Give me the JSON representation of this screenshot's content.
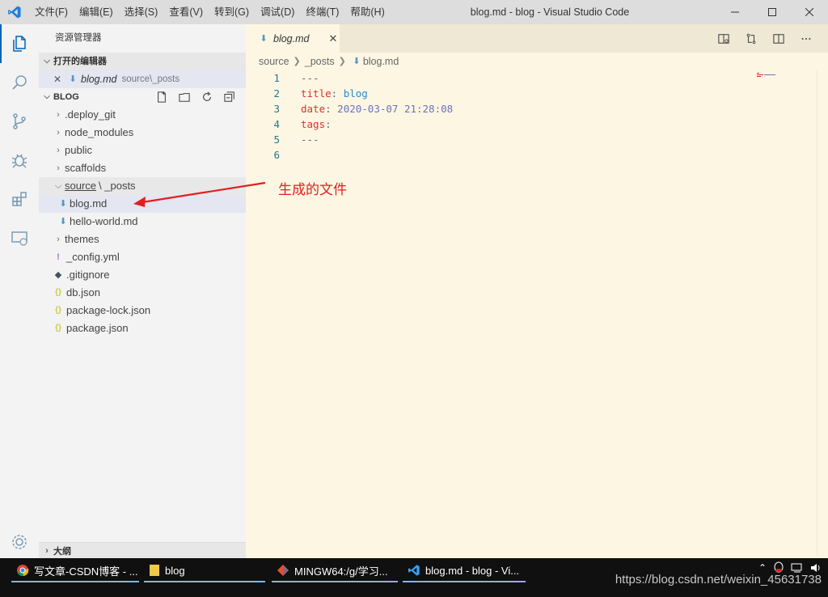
{
  "window": {
    "title": "blog.md - blog - Visual Studio Code"
  },
  "menu": [
    "文件(F)",
    "编辑(E)",
    "选择(S)",
    "查看(V)",
    "转到(G)",
    "调试(D)",
    "终端(T)",
    "帮助(H)"
  ],
  "sidebar": {
    "title": "资源管理器",
    "open_editors_label": "打开的编辑器",
    "open_editor": {
      "name": "blog.md",
      "path": "source\\_posts"
    },
    "folder_label": "BLOG",
    "tree": [
      {
        "label": ".deploy_git",
        "kind": "folder"
      },
      {
        "label": "node_modules",
        "kind": "folder"
      },
      {
        "label": "public",
        "kind": "folder"
      },
      {
        "label": "scaffolds",
        "kind": "folder"
      },
      {
        "label": "source",
        "sub": "\\ _posts",
        "kind": "folder-open"
      },
      {
        "label": "blog.md",
        "kind": "md"
      },
      {
        "label": "hello-world.md",
        "kind": "md"
      },
      {
        "label": "themes",
        "kind": "folder"
      },
      {
        "label": "_config.yml",
        "kind": "yml"
      },
      {
        "label": ".gitignore",
        "kind": "git"
      },
      {
        "label": "db.json",
        "kind": "json"
      },
      {
        "label": "package-lock.json",
        "kind": "json"
      },
      {
        "label": "package.json",
        "kind": "json"
      }
    ],
    "outline_label": "大纲"
  },
  "editor": {
    "tab_label": "blog.md",
    "breadcrumb": [
      "source",
      "_posts",
      "blog.md"
    ],
    "lines": [
      {
        "n": "1",
        "key": "---",
        "val": ""
      },
      {
        "n": "2",
        "key": "title",
        "val": "blog"
      },
      {
        "n": "3",
        "key": "date",
        "val": "2020-03-07 21:28:08"
      },
      {
        "n": "4",
        "key": "tags",
        "val": ""
      },
      {
        "n": "5",
        "key": "---",
        "val": ""
      },
      {
        "n": "6",
        "key": "",
        "val": ""
      }
    ]
  },
  "annotation": "生成的文件",
  "taskbar": {
    "items": [
      "写文章-CSDN博客 - ...",
      "blog",
      "MINGW64:/g/学习...",
      "blog.md - blog - Vi..."
    ],
    "watermark": "https://blog.csdn.net/weixin_45631738"
  },
  "colors": {
    "accent": "#0066b8",
    "annotation": "#e02020",
    "editor_bg": "#fdf6e3"
  }
}
